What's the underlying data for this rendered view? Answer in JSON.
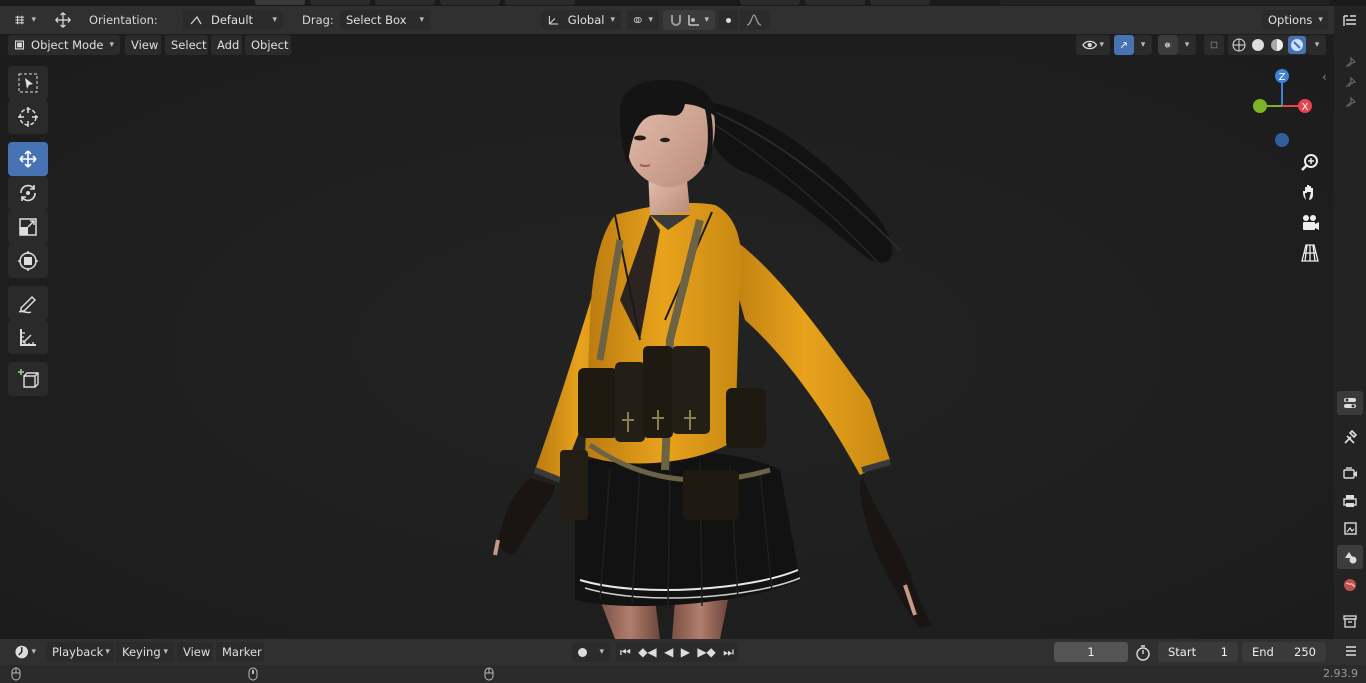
{
  "header": {
    "orientation_label": "Orientation:",
    "orientation_value": "Default",
    "drag_label": "Drag:",
    "drag_value": "Select Box",
    "transform_orientation": "Global",
    "options_label": "Options"
  },
  "viewport_menu": {
    "mode": "Object Mode",
    "view": "View",
    "select": "Select",
    "add": "Add",
    "object": "Object"
  },
  "gizmo": {
    "z": "Z",
    "x": "X"
  },
  "timeline": {
    "playback": "Playback",
    "keying": "Keying",
    "view": "View",
    "marker": "Marker",
    "current_frame": "1",
    "start_label": "Start",
    "start_value": "1",
    "end_label": "End",
    "end_value": "250"
  },
  "status": {
    "version": "2.93.9"
  },
  "colors": {
    "accent": "#4772b3",
    "axis_x": "#e8414f",
    "axis_y": "#7fb22b",
    "axis_z": "#3f83d6",
    "jacket": "#e8a21c"
  },
  "tools": [
    "select-box-tool",
    "cursor-tool",
    "move-tool",
    "rotate-tool",
    "scale-tool",
    "transform-tool",
    "annotate-tool",
    "measure-tool",
    "add-cube-tool"
  ]
}
